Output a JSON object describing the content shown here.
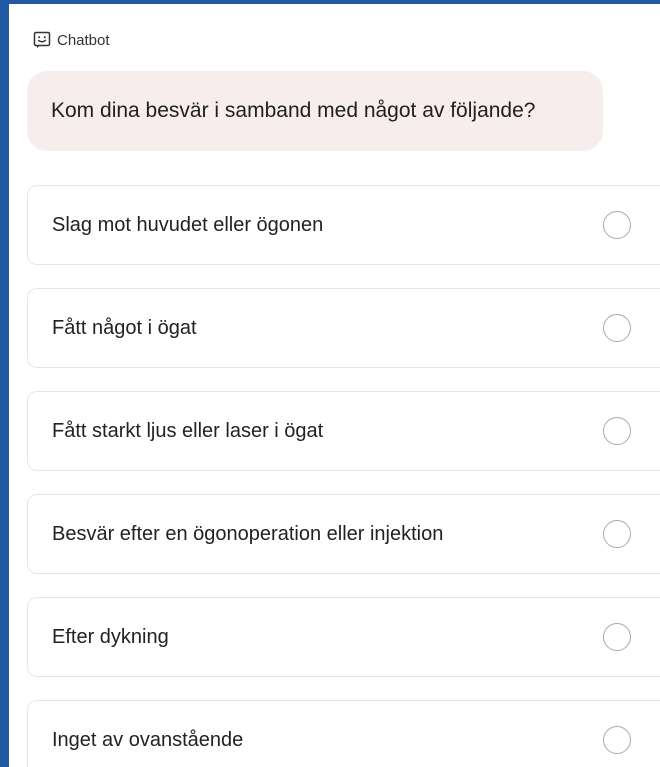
{
  "header": {
    "icon": "chatbot-face-icon",
    "title": "Chatbot"
  },
  "message": {
    "text": "Kom dina besvär i samband med något av följande?"
  },
  "options": [
    {
      "label": "Slag mot huvudet eller ögonen",
      "selected": false
    },
    {
      "label": "Fått något i ögat",
      "selected": false
    },
    {
      "label": "Fått starkt ljus eller laser i ögat",
      "selected": false
    },
    {
      "label": "Besvär efter en ögonoperation eller injektion",
      "selected": false
    },
    {
      "label": "Efter dykning",
      "selected": false
    },
    {
      "label": "Inget av ovanstående",
      "selected": false
    }
  ],
  "colors": {
    "accent_border": "#1f5aa3",
    "bubble_background": "#f8eded",
    "radio_border": "#a9a9a9"
  }
}
